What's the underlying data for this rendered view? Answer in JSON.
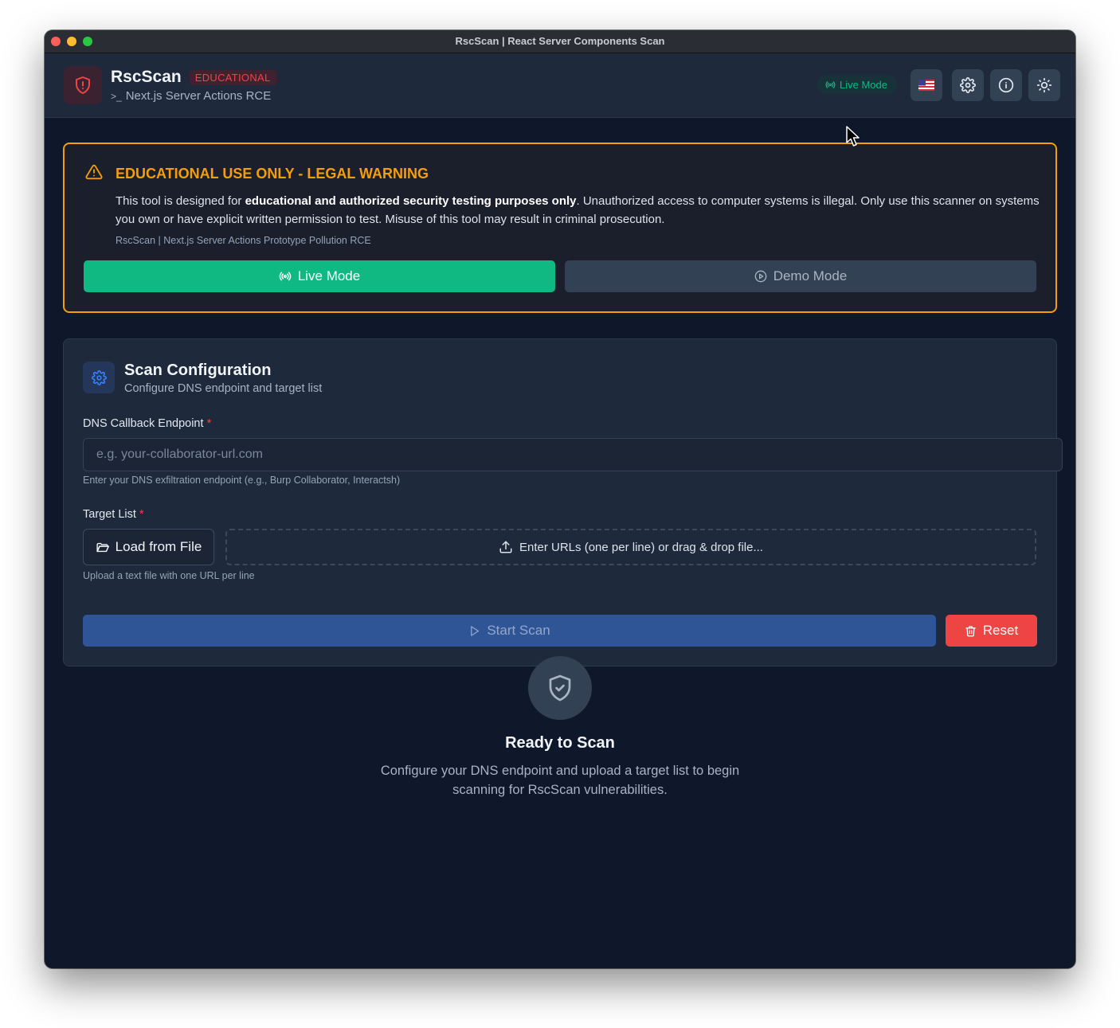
{
  "window": {
    "title": "RscScan | React Server Components Scan"
  },
  "header": {
    "brand": "RscScan",
    "badge": "EDUCATIONAL",
    "subtitle_prefix": ">_",
    "subtitle": "Next.js Server Actions RCE",
    "mode_pill": "Live Mode",
    "icons": [
      "us-flag-icon",
      "gear-icon",
      "info-icon",
      "sun-icon"
    ]
  },
  "warning": {
    "title": "EDUCATIONAL USE ONLY - LEGAL WARNING",
    "text_pre": "This tool is designed for ",
    "text_bold": "educational and authorized security testing purposes only",
    "text_post": ". Unauthorized access to computer systems is illegal. Only use this scanner on systems you own or have explicit written permission to test. Misuse of this tool may result in criminal prosecution.",
    "footer": "RscScan | Next.js Server Actions Prototype Pollution RCE",
    "live_button": "Live Mode",
    "demo_button": "Demo Mode"
  },
  "config": {
    "title": "Scan Configuration",
    "subtitle": "Configure DNS endpoint and target list",
    "dns_label": "DNS Callback Endpoint",
    "required_mark": "*",
    "dns_placeholder": "e.g. your-collaborator-url.com",
    "dns_value": "",
    "dns_hint": "Enter your DNS exfiltration endpoint (e.g., Burp Collaborator, Interactsh)",
    "target_label": "Target List",
    "load_button": "Load from File",
    "dropzone_text": "Enter URLs (one per line) or drag & drop file...",
    "target_hint": "Upload a text file with one URL per line",
    "start_button": "Start Scan",
    "reset_button": "Reset"
  },
  "empty_state": {
    "title": "Ready to Scan",
    "text": "Configure your DNS endpoint and upload a target list to begin scanning for RscScan vulnerabilities."
  },
  "colors": {
    "background": "#0f172a",
    "panel": "#1e293b",
    "accent_green": "#10b981",
    "warning": "#f59e0b",
    "danger": "#ef4444",
    "primary": "#2f5597"
  }
}
